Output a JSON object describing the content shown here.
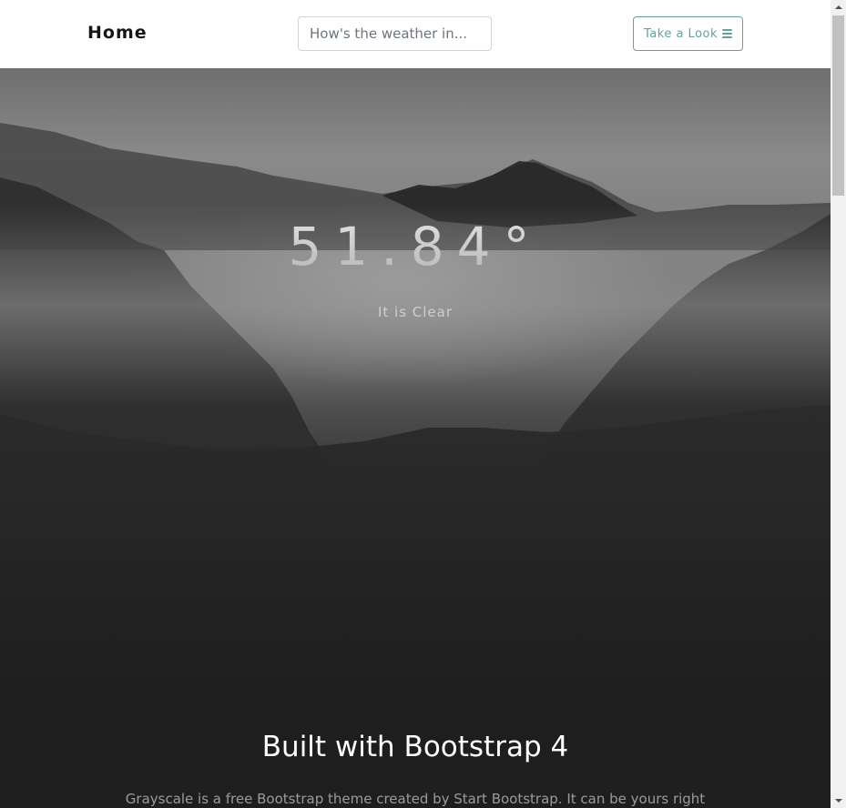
{
  "navbar": {
    "brand": "Home",
    "search_placeholder": "How's the weather in...",
    "menu_label": "Take a Look",
    "menu_icon": "bars-icon",
    "accent_color": "#64a19d"
  },
  "hero": {
    "temperature": "51.84°",
    "condition": "It is Clear"
  },
  "about": {
    "title": "Built with Bootstrap 4",
    "text": "Grayscale is a free Bootstrap theme created by Start Bootstrap. It can be yours right"
  }
}
